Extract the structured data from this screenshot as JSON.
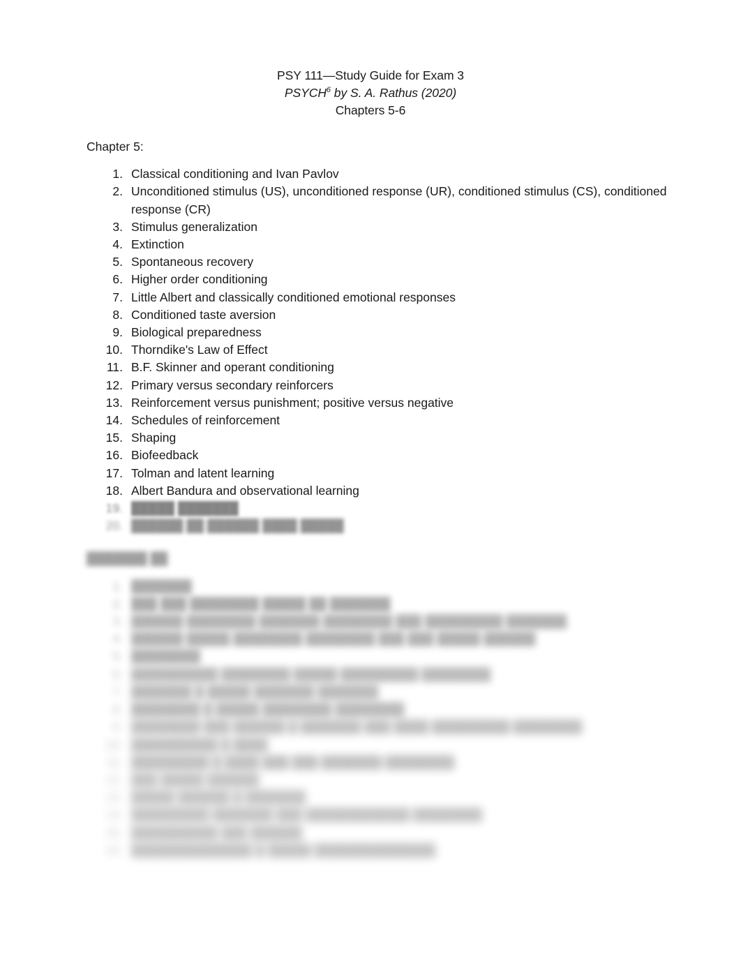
{
  "document": {
    "title_lines": [
      {
        "text": "PSY 111—Study Guide for Exam 3",
        "style": "normal"
      },
      {
        "text_before": "PSYCH",
        "superscript": "6",
        "text_after": " by S. A. Rathus (2020)",
        "style": "italic"
      },
      {
        "text": "Chapters 5-6",
        "style": "normal"
      }
    ],
    "title_plain": {
      "line1": "PSY 111—Study Guide for Exam 3",
      "line2_before": "PSYCH",
      "line2_sup": "6",
      "line2_after": " by S. A. Rathus (2020)",
      "line3": "Chapters 5-6"
    }
  },
  "chapter5": {
    "heading": "Chapter 5:",
    "items": [
      {
        "num": "1.",
        "text": "Classical conditioning and Ivan Pavlov"
      },
      {
        "num": "2.",
        "text": "Unconditioned stimulus (US), unconditioned response (UR), conditioned stimulus (CS), conditioned response (CR)"
      },
      {
        "num": "3.",
        "text": "Stimulus generalization"
      },
      {
        "num": "4.",
        "text": "Extinction"
      },
      {
        "num": "5.",
        "text": "Spontaneous recovery"
      },
      {
        "num": "6.",
        "text": "Higher order conditioning"
      },
      {
        "num": "7.",
        "text": "Little Albert and classically conditioned emotional responses"
      },
      {
        "num": "8.",
        "text": "Conditioned taste aversion"
      },
      {
        "num": "9.",
        "text": "Biological preparedness"
      },
      {
        "num": "10.",
        "text": "Thorndike's Law of Effect"
      },
      {
        "num": "11.",
        "text": "B.F. Skinner and operant conditioning"
      },
      {
        "num": "12.",
        "text": "Primary versus secondary reinforcers"
      },
      {
        "num": "13.",
        "text": "Reinforcement versus punishment; positive versus negative"
      },
      {
        "num": "14.",
        "text": "Schedules of reinforcement"
      },
      {
        "num": "15.",
        "text": "Shaping"
      },
      {
        "num": "16.",
        "text": "Biofeedback"
      },
      {
        "num": "17.",
        "text": "Tolman and latent learning"
      },
      {
        "num": "18.",
        "text": "Albert Bandura and observational learning"
      }
    ],
    "obscured_items": [
      {
        "num": "19.",
        "text": "█████ ███████"
      },
      {
        "num": "20.",
        "text": "██████ ██ ██████ ████ █████"
      }
    ]
  },
  "chapter6": {
    "heading_obscured": "███████ ██",
    "obscured_items": [
      {
        "num": "1.",
        "text": "███████"
      },
      {
        "num": "2.",
        "text": "███ ███ ████████ █████ ██ ███████"
      },
      {
        "num": "3.",
        "text": "██████ ████████ ███████ ████████ ███ █████████ ███████"
      },
      {
        "num": "4.",
        "text": "██████ █████ ████████ ████████ ███ ███ █████ ██████"
      },
      {
        "num": "5.",
        "text": "████████"
      },
      {
        "num": "6.",
        "text": "██████████ ████████ █████ █████████ ████████"
      },
      {
        "num": "7.",
        "text": "███████ █ █████ ███████ ███████"
      },
      {
        "num": "8.",
        "text": "████████ █ █████ ████████ ████████"
      },
      {
        "num": "9.",
        "text": "████████ ███ ██████ █ ███████ ███ ████ █████████ ████████"
      },
      {
        "num": "10.",
        "text": "██████████ █ ████"
      },
      {
        "num": "11.",
        "text": "█████████ █ ████ ███ ███ ███████ ████████"
      },
      {
        "num": "12.",
        "text": "███ █████ ██████"
      },
      {
        "num": "13.",
        "text": "█████ ██████ █ ███████"
      },
      {
        "num": "14.",
        "text": "█████████ ███████ ███ ████████████ ████████"
      },
      {
        "num": "15.",
        "text": "██████████ ███ ██████"
      },
      {
        "num": "16.",
        "text": "██████████████ █ █████ ██████████████"
      }
    ]
  },
  "colors": {
    "page_background": "#ffffff",
    "text": "#1a1a1a",
    "obscured_text": "#3a3a3a"
  }
}
